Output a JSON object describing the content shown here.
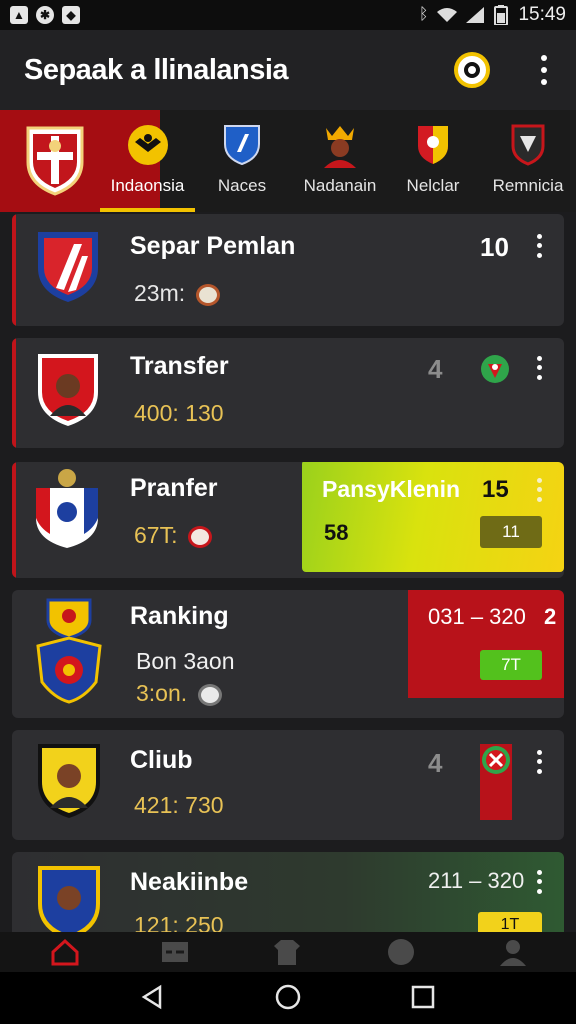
{
  "status_bar": {
    "time": "15:49",
    "left_icons": [
      "image-icon",
      "soccer-ball-icon",
      "photo-icon"
    ],
    "right_icons": [
      "bluetooth-icon",
      "wifi-icon",
      "signal-icon",
      "battery-icon"
    ]
  },
  "app_bar": {
    "title": "Sepaak a llinalansia",
    "search_icon": "search-icon",
    "menu_icon": "more-vert-icon"
  },
  "tabs": [
    {
      "label": "Indaonsia",
      "active": true
    },
    {
      "label": "Naces",
      "active": false
    },
    {
      "label": "Nadanain",
      "active": false
    },
    {
      "label": "Nelclar",
      "active": false
    },
    {
      "label": "Remnicia",
      "active": false
    }
  ],
  "cards": [
    {
      "title": "Separ Pemlan",
      "subtitle": "23m:",
      "count": "10"
    },
    {
      "title": "Transfer",
      "subtitle": "400: 130",
      "count": "4"
    },
    {
      "title": "Pranfer",
      "subtitle": "67T:",
      "count": "15",
      "promo": {
        "title": "PansyKlenin",
        "value": "58",
        "pill": "11"
      }
    },
    {
      "title": "Ranking",
      "subtitle": "Bon 3aon",
      "subtitle2": "3:on.",
      "score": "031 – 320",
      "score_count": "2",
      "pill": "7T"
    },
    {
      "title": "Cliub",
      "subtitle": "421: 730",
      "count": "4"
    },
    {
      "title": "Neakiinbe",
      "subtitle": "121: 250",
      "score": "211 – 320",
      "pill": "1T"
    }
  ],
  "bottom_nav": [
    "home-icon",
    "scoreboard-icon",
    "shirt-icon",
    "ball-icon",
    "profile-icon"
  ],
  "system_nav": [
    "back-icon",
    "home-circle-icon",
    "recents-icon"
  ],
  "colors": {
    "accent_red": "#c0141a",
    "accent_yellow": "#f2c200",
    "card_bg": "#2e2e31",
    "promo_green": "#8cd11a"
  }
}
